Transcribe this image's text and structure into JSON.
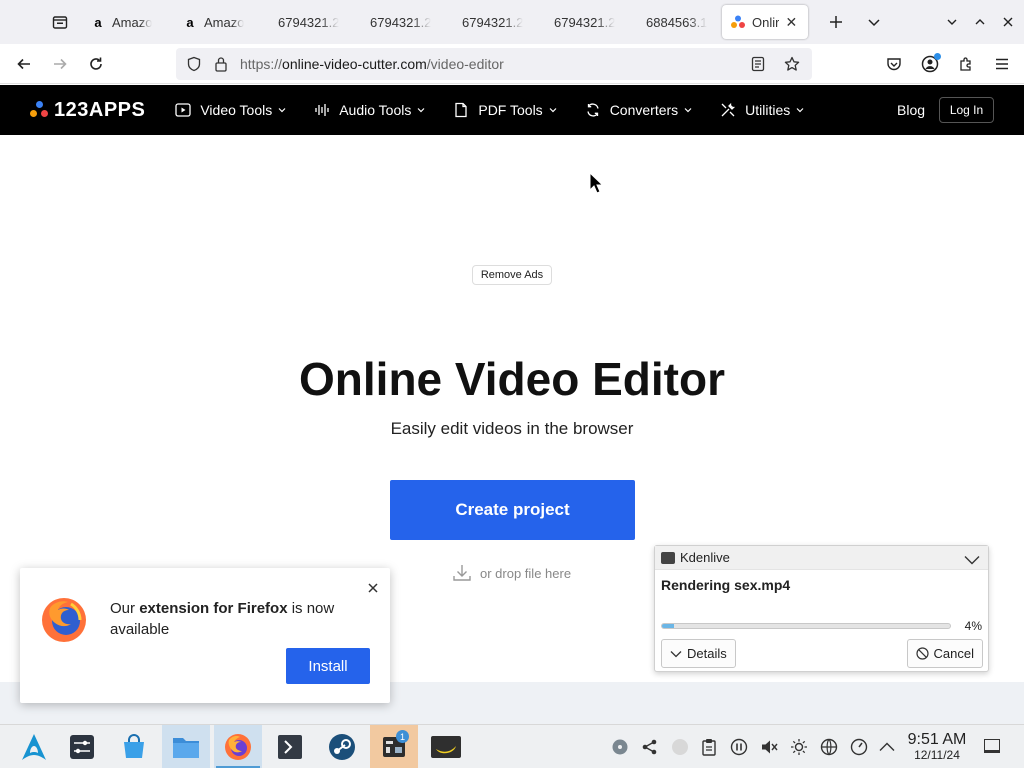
{
  "tabs": [
    {
      "label": "Amazo",
      "favicon": "amazon-icon"
    },
    {
      "label": "Amazo",
      "favicon": "amazon-icon"
    },
    {
      "label": "6794321.2",
      "favicon": ""
    },
    {
      "label": "6794321.2",
      "favicon": ""
    },
    {
      "label": "6794321.2",
      "favicon": ""
    },
    {
      "label": "6794321.2",
      "favicon": ""
    },
    {
      "label": "6884563.1",
      "favicon": ""
    },
    {
      "label": "Onlir",
      "favicon": "123apps-icon",
      "active": true
    }
  ],
  "address": {
    "scheme": "https://",
    "host": "online-video-cutter.com",
    "path": "/video-editor"
  },
  "site": {
    "logo_text": "123APPS",
    "menu": [
      {
        "label": "Video Tools",
        "icon": "video-icon"
      },
      {
        "label": "Audio Tools",
        "icon": "audio-wave-icon"
      },
      {
        "label": "PDF Tools",
        "icon": "pdf-file-icon"
      },
      {
        "label": "Converters",
        "icon": "convert-icon"
      },
      {
        "label": "Utilities",
        "icon": "utilities-icon"
      }
    ],
    "blog": "Blog",
    "login": "Log In"
  },
  "main": {
    "remove_ads": "Remove Ads",
    "title": "Online Video Editor",
    "subtitle": "Easily edit videos in the browser",
    "create_button": "Create project",
    "drop_text": "or drop file here"
  },
  "firefox_popup": {
    "text_pre": "Our ",
    "text_bold": "extension for Firefox",
    "text_post": " is now available",
    "install": "Install"
  },
  "kdenlive": {
    "app": "Kdenlive",
    "title": "Rendering sex.mp4",
    "progress": 0.04,
    "progress_label": "4%",
    "details": "Details",
    "cancel": "Cancel"
  },
  "taskbar": {
    "time": "9:51 AM",
    "date": "12/11/24",
    "notification_badge": "1"
  },
  "colors": {
    "accent_blue": "#2563eb",
    "site_header": "#000000",
    "progress_fill": "#6bb6e6"
  }
}
